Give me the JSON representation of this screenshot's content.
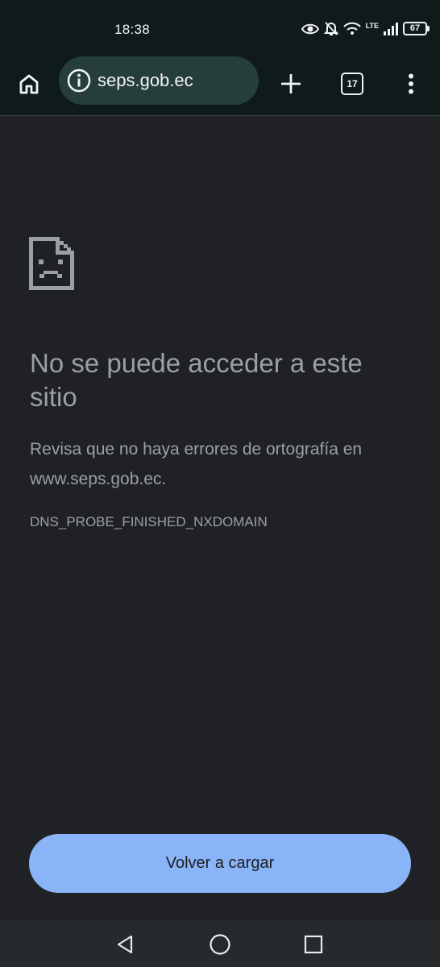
{
  "status_bar": {
    "time": "18:38",
    "network": "LTE",
    "battery": "67"
  },
  "toolbar": {
    "url": "seps.gob.ec",
    "tab_count": "17"
  },
  "error_page": {
    "title": "No se puede acceder a este sitio",
    "description": "Revisa que no haya errores de ortografía en www.seps.gob.ec.",
    "error_code": "DNS_PROBE_FINISHED_NXDOMAIN",
    "reload_label": "Volver a cargar"
  },
  "colors": {
    "page_background": "#202124",
    "toolbar_background": "#0f1a1a",
    "omnibox_background": "#253d3b",
    "button_accent": "#8ab4f8",
    "text_muted": "#9aa0a6"
  },
  "icons": {
    "status": [
      "eye-icon",
      "bell-off-icon",
      "wifi-icon",
      "signal-icon",
      "battery-icon"
    ],
    "toolbar": [
      "home-icon",
      "info-icon",
      "plus-icon",
      "tab-switcher-icon",
      "more-vert-icon"
    ],
    "page": [
      "sad-document-icon"
    ],
    "navigation": [
      "back-triangle-icon",
      "home-circle-icon",
      "recents-square-icon"
    ]
  }
}
